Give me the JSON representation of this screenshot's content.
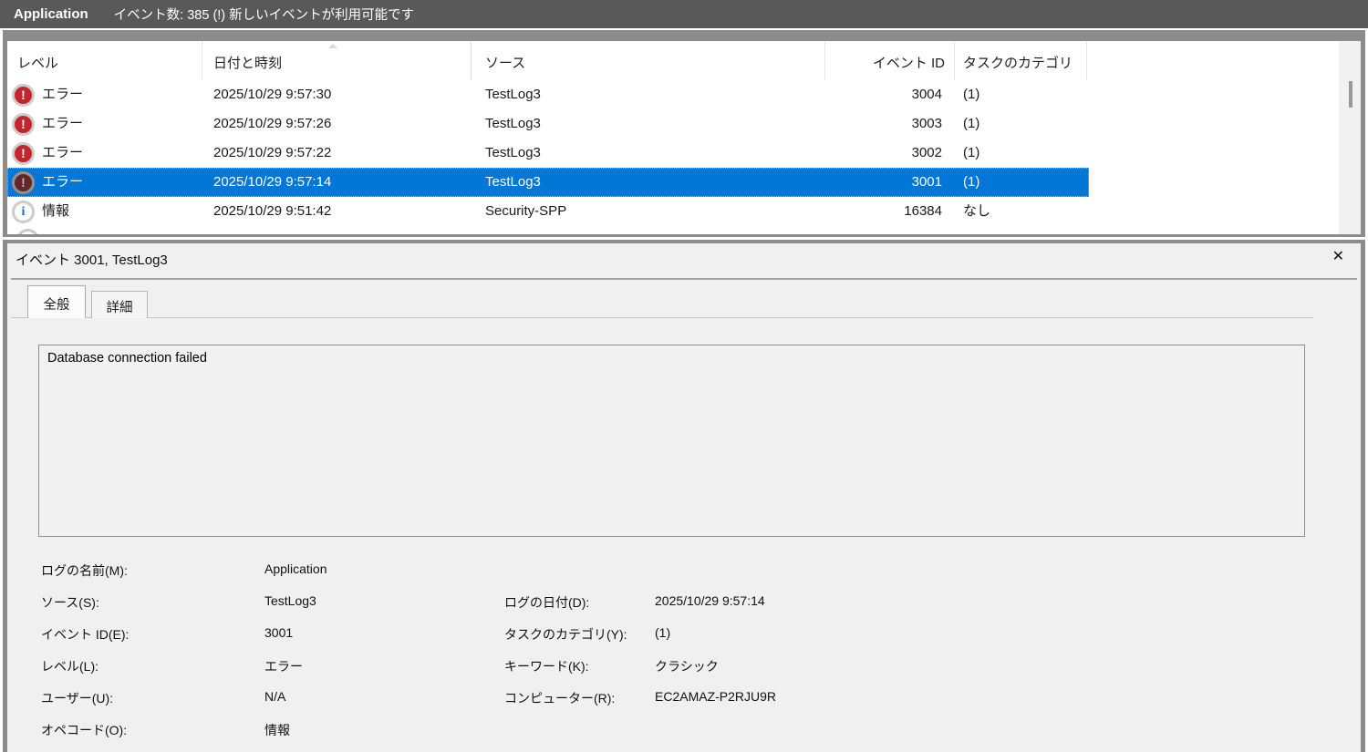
{
  "topbar": {
    "log_name": "Application",
    "status": "イベント数: 385 (!) 新しいイベントが利用可能です"
  },
  "event_table": {
    "columns": [
      "レベル",
      "日付と時刻",
      "ソース",
      "イベント ID",
      "タスクのカテゴリ"
    ],
    "rows": [
      {
        "icon": "error-icon",
        "icon_glyph": "!",
        "level": "エラー",
        "datetime": "2025/10/29 9:57:30",
        "source": "TestLog3",
        "event_id": "3004",
        "category": "(1)",
        "selected": false
      },
      {
        "icon": "error-icon",
        "icon_glyph": "!",
        "level": "エラー",
        "datetime": "2025/10/29 9:57:26",
        "source": "TestLog3",
        "event_id": "3003",
        "category": "(1)",
        "selected": false
      },
      {
        "icon": "error-icon",
        "icon_glyph": "!",
        "level": "エラー",
        "datetime": "2025/10/29 9:57:22",
        "source": "TestLog3",
        "event_id": "3002",
        "category": "(1)",
        "selected": false
      },
      {
        "icon": "error-icon",
        "icon_glyph": "!",
        "level": "エラー",
        "datetime": "2025/10/29 9:57:14",
        "source": "TestLog3",
        "event_id": "3001",
        "category": "(1)",
        "selected": true
      },
      {
        "icon": "info-icon",
        "icon_glyph": "i",
        "level": "情報",
        "datetime": "2025/10/29 9:51:42",
        "source": "Security-SPP",
        "event_id": "16384",
        "category": "なし",
        "selected": false
      }
    ]
  },
  "detail_panel": {
    "title": "イベント 3001, TestLog3",
    "close_glyph": "✕",
    "tabs": [
      {
        "label": "全般",
        "active": true
      },
      {
        "label": "詳細",
        "active": false
      }
    ],
    "message": "Database connection failed",
    "fields": [
      {
        "label_left": "ログの名前(M):",
        "value_left": "Application",
        "label_right": "",
        "value_right": ""
      },
      {
        "label_left": "ソース(S):",
        "value_left": "TestLog3",
        "label_right": "ログの日付(D):",
        "value_right": "2025/10/29 9:57:14"
      },
      {
        "label_left": "イベント ID(E):",
        "value_left": "3001",
        "label_right": "タスクのカテゴリ(Y):",
        "value_right": "(1)"
      },
      {
        "label_left": "レベル(L):",
        "value_left": "エラー",
        "label_right": "キーワード(K):",
        "value_right": "クラシック"
      },
      {
        "label_left": "ユーザー(U):",
        "value_left": "N/A",
        "label_right": "コンピューター(R):",
        "value_right": "EC2AMAZ-P2RJU9R"
      },
      {
        "label_left": "オペコード(O):",
        "value_left": "情報",
        "label_right": "",
        "value_right": ""
      }
    ]
  },
  "colors": {
    "selection_blue": "#0277d8",
    "error_red": "#c5262c",
    "info_blue": "#1a68d6",
    "topbar_gray": "#595959",
    "panel_gray": "#f0f0f0",
    "frame_gray": "#8c8c8c"
  }
}
